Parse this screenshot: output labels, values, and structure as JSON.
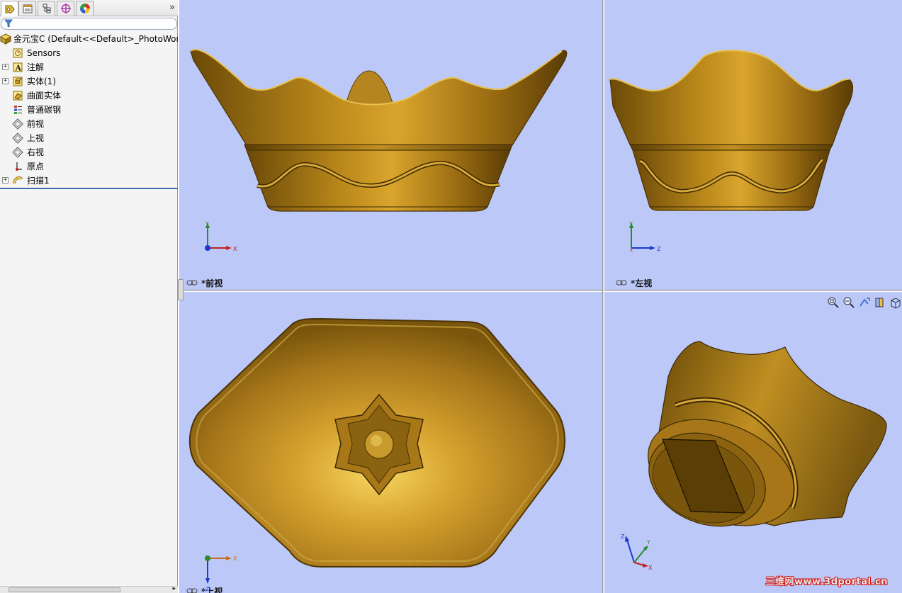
{
  "tabs": [
    {
      "name": "feature-manager",
      "icon": "feature-tree-icon",
      "active": true
    },
    {
      "name": "property-manager",
      "icon": "property-manager-icon",
      "active": false
    },
    {
      "name": "configuration-manager",
      "icon": "configuration-manager-icon",
      "active": false
    },
    {
      "name": "dimxpert-manager",
      "icon": "target-icon",
      "active": false
    },
    {
      "name": "display-manager",
      "icon": "color-wheel-icon",
      "active": false
    }
  ],
  "tab_overflow": "»",
  "filter": {
    "icon": "filter-icon",
    "value": ""
  },
  "tree": {
    "root": "金元宝C  (Default<<Default>_PhotoWor",
    "items": [
      {
        "label": "Sensors",
        "icon": "sensor-icon",
        "expander": ""
      },
      {
        "label": "注解",
        "icon": "annotation-icon",
        "expander": "+"
      },
      {
        "label": "实体(1)",
        "icon": "solid-body-icon",
        "expander": "+"
      },
      {
        "label": "曲面实体",
        "icon": "surface-body-icon",
        "expander": ""
      },
      {
        "label": "普通碳钢",
        "icon": "material-icon",
        "expander": ""
      },
      {
        "label": "前视",
        "icon": "plane-icon",
        "expander": ""
      },
      {
        "label": "上视",
        "icon": "plane-icon",
        "expander": ""
      },
      {
        "label": "右视",
        "icon": "plane-icon",
        "expander": ""
      },
      {
        "label": "原点",
        "icon": "origin-icon",
        "expander": ""
      },
      {
        "label": "扫描1",
        "icon": "sweep-icon",
        "expander": "+"
      }
    ]
  },
  "viewports": {
    "front": {
      "label": "*前视",
      "axes": [
        "Y",
        "X"
      ]
    },
    "left": {
      "label": "*左视",
      "axes": [
        "Y",
        "Z",
        "X"
      ]
    },
    "top": {
      "label": "*上视",
      "axes": [
        "X",
        "Z"
      ]
    },
    "iso": {
      "axes": [
        "Z",
        "Y",
        "X"
      ]
    }
  },
  "view_toolbar": [
    "zoom-to-fit-icon",
    "zoom-to-area-icon",
    "previous-view-icon",
    "section-view-icon",
    "view-orientation-icon"
  ],
  "watermark": "三维网www.3dportal.cn",
  "colors": {
    "viewport_bg": "#bcc8f7",
    "gold_dark": "#6b4a08",
    "gold_mid": "#b8860b",
    "gold_light": "#f2cf5a"
  }
}
